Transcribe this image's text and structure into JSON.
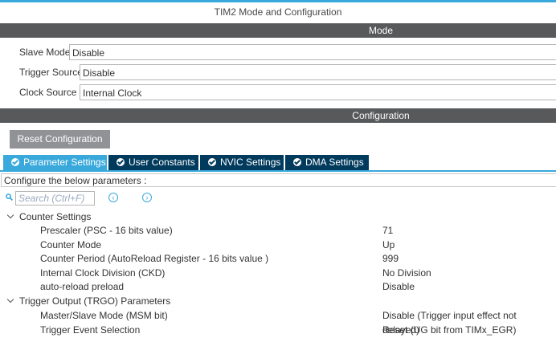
{
  "window": {
    "title": "TIM2 Mode and Configuration"
  },
  "mode_section": {
    "header": "Mode",
    "fields": [
      {
        "label": "Slave Mode",
        "value": "Disable"
      },
      {
        "label": "Trigger Source",
        "value": "Disable"
      },
      {
        "label": "Clock Source",
        "value": "Internal Clock"
      }
    ]
  },
  "config_section": {
    "header": "Configuration",
    "reset_label": "Reset Configuration",
    "tabs": [
      {
        "label": "Parameter Settings",
        "active": true
      },
      {
        "label": "User Constants",
        "active": false
      },
      {
        "label": "NVIC Settings",
        "active": false
      },
      {
        "label": "DMA Settings",
        "active": false
      }
    ],
    "instruction": "Configure the below parameters :",
    "search": {
      "placeholder": "Search (Ctrl+F)",
      "prev_icon": "chevron-left-icon",
      "next_icon": "chevron-right-icon"
    }
  },
  "parameters": {
    "counter_group": "Counter Settings",
    "counter_items": [
      {
        "name": "Prescaler (PSC - 16 bits value)",
        "value": "71"
      },
      {
        "name": "Counter Mode",
        "value": "Up"
      },
      {
        "name": "Counter Period (AutoReload Register - 16 bits value )",
        "value": "999"
      },
      {
        "name": "Internal Clock Division (CKD)",
        "value": "No Division"
      },
      {
        "name": "auto-reload preload",
        "value": "Disable"
      }
    ],
    "trgo_group": "Trigger Output (TRGO) Parameters",
    "trgo_items": [
      {
        "name": "Master/Slave Mode (MSM bit)",
        "value": "Disable (Trigger input effect not delayed)"
      },
      {
        "name": "Trigger Event Selection",
        "value": "Reset (UG bit from TIMx_EGR)"
      }
    ]
  },
  "colors": {
    "accent": "#39a9dc",
    "tab_dark": "#003a5d",
    "section_bar": "#58595b",
    "button_gray": "#909296"
  }
}
